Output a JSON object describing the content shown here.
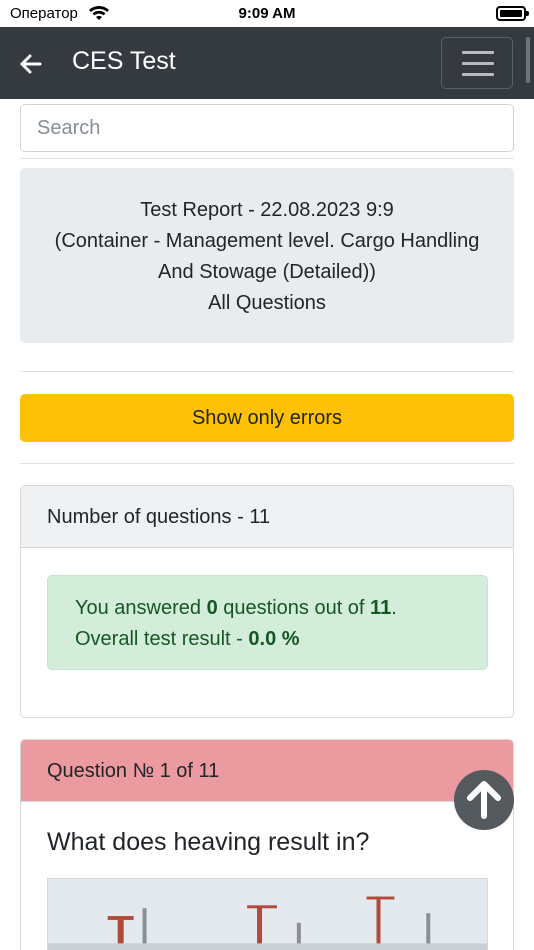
{
  "status_bar": {
    "carrier": "Оператор",
    "time": "9:09 AM"
  },
  "navbar": {
    "title": "CES Test"
  },
  "search": {
    "placeholder": "Search"
  },
  "report": {
    "line1": "Test Report - 22.08.2023 9:9",
    "line2": "(Container - Management level. Cargo Handling",
    "line3": "And Stowage (Detailed))",
    "line4": "All Questions"
  },
  "filter_button": {
    "label": "Show only errors"
  },
  "summary": {
    "header": "Number of questions - 11",
    "answered_prefix": "You answered ",
    "answered_count": "0",
    "answered_middle": " questions out of ",
    "total_questions": "11",
    "answered_suffix": ".",
    "result_prefix": "Overall test result - ",
    "result_value": "0.0 %"
  },
  "question": {
    "header": "Question № 1 of 11",
    "text": "What does heaving result in?"
  },
  "colors": {
    "navbar_bg": "#343a40",
    "warning": "#ffc107",
    "success_bg": "#d4edda",
    "success_text": "#155724",
    "danger_header": "#eb9a9f"
  },
  "icons": {
    "back": "arrow-left-icon",
    "menu": "hamburger-menu-icon",
    "scroll_top": "arrow-up-circle-icon",
    "wifi": "wifi-icon",
    "battery": "battery-icon"
  }
}
